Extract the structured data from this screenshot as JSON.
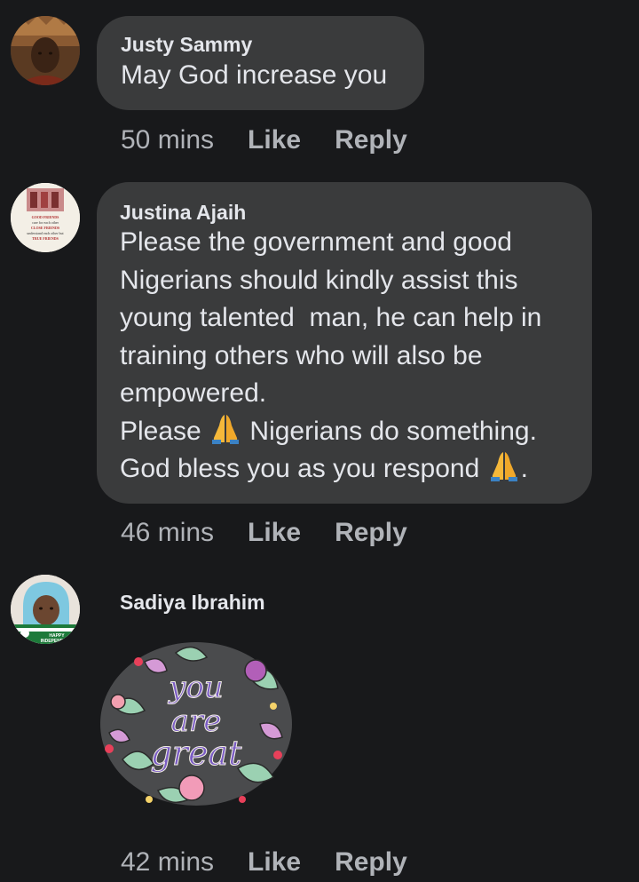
{
  "comments": [
    {
      "author": "Justy Sammy",
      "text": "May God increase you",
      "time": "50 mins",
      "like_label": "Like",
      "reply_label": "Reply"
    },
    {
      "author": "Justina Ajaih",
      "text_lines": [
        "Please the government and good",
        "Nigerians should kindly assist this",
        "young talented  man, he can help in",
        "training others who will also be",
        "empowered."
      ],
      "line6_before": "Please ",
      "line6_after": " Nigerians do something.",
      "line7_before": "God bless you as you respond ",
      "line7_after": ".",
      "emoji": "folded-hands",
      "time": "46 mins",
      "like_label": "Like",
      "reply_label": "Reply",
      "avatar_text": [
        "GOOD FRIENDS",
        "care for each other",
        "CLOSE FRIENDS",
        "understand each other but",
        "TRUE FRIENDS"
      ]
    },
    {
      "author": "Sadiya Ibrahim",
      "sticker_text": [
        "you",
        "are",
        "great"
      ],
      "time": "42 mins",
      "like_label": "Like",
      "reply_label": "Reply",
      "avatar_text": [
        "HAPPY",
        "INDEPENDEN"
      ]
    }
  ],
  "colors": {
    "background": "#18191b",
    "bubble": "#3a3b3c",
    "text": "#e4e6eb",
    "meta": "#b0b3b8"
  }
}
